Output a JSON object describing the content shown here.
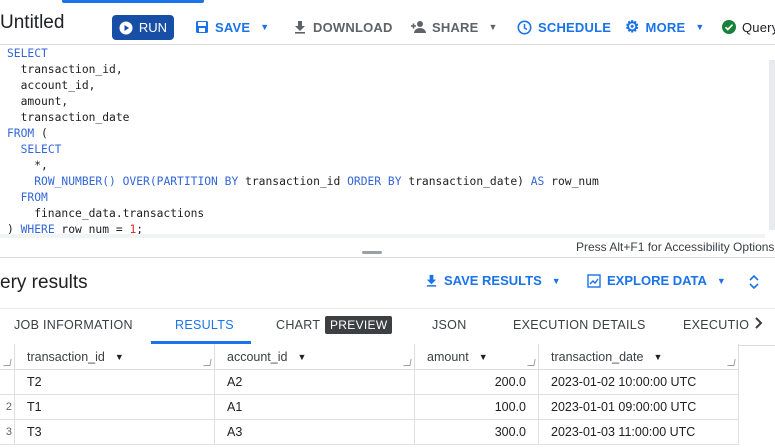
{
  "toolbar": {
    "title": "Untitled",
    "run_label": "RUN",
    "save_label": "SAVE",
    "download_label": "DOWNLOAD",
    "share_label": "SHARE",
    "schedule_label": "SCHEDULE",
    "more_label": "MORE",
    "status_label": "Query"
  },
  "editor": {
    "accessibility_hint": "Press Alt+F1 for Accessibility Options"
  },
  "results": {
    "title": "ery results",
    "save_results_label": "SAVE RESULTS",
    "explore_data_label": "EXPLORE DATA",
    "tabs": [
      {
        "label": "JOB INFORMATION"
      },
      {
        "label": "RESULTS"
      },
      {
        "label": "CHART"
      },
      {
        "label": "JSON"
      },
      {
        "label": "EXECUTION DETAILS"
      },
      {
        "label": "EXECUTIO"
      }
    ],
    "preview_badge": "PREVIEW",
    "columns": [
      "transaction_id",
      "account_id",
      "amount",
      "transaction_date"
    ],
    "rows": [
      {
        "num": "",
        "cells": [
          "T2",
          "A2",
          "200.0",
          "2023-01-02 10:00:00 UTC"
        ]
      },
      {
        "num": "2",
        "cells": [
          "T1",
          "A1",
          "100.0",
          "2023-01-01 09:00:00 UTC"
        ]
      },
      {
        "num": "3",
        "cells": [
          "T3",
          "A3",
          "300.0",
          "2023-01-03 11:00:00 UTC"
        ]
      }
    ]
  },
  "colors": {
    "accent": "#1a73e8",
    "run_button": "#174ea6",
    "status_ok": "#188038"
  }
}
